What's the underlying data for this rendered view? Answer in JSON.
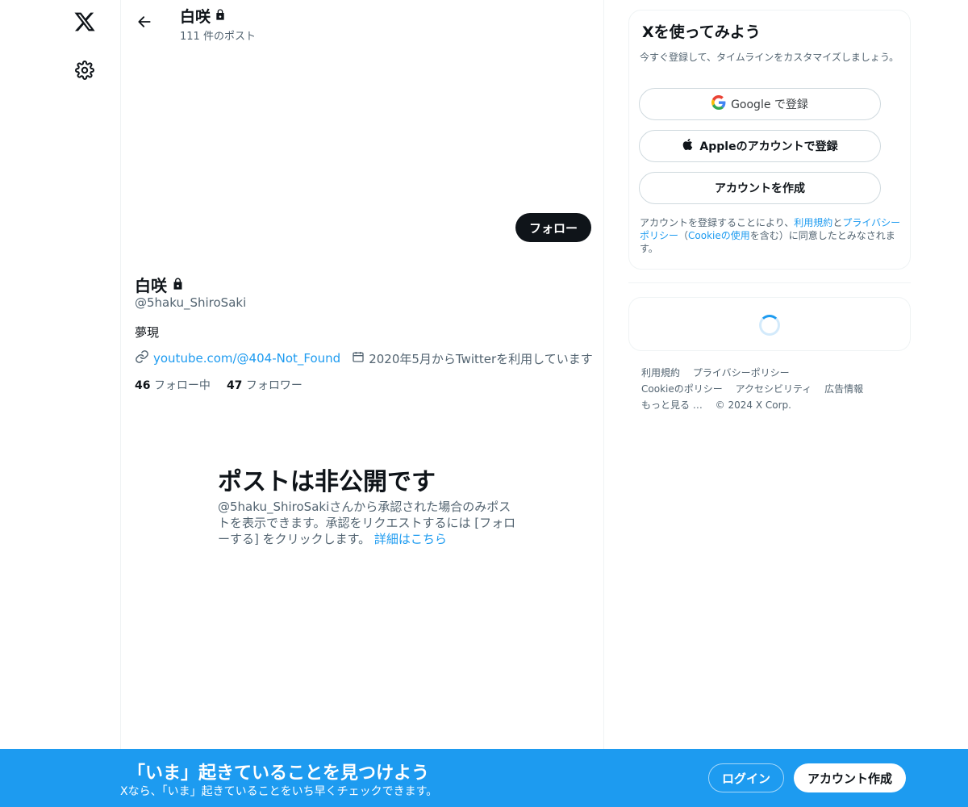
{
  "nav": {
    "logo_icon": "x-logo-icon",
    "settings_icon": "gear-icon"
  },
  "header": {
    "display_name": "白咲",
    "post_count": "111 件のポスト"
  },
  "profile": {
    "follow_label": "フォロー",
    "display_name": "白咲",
    "handle": "@5haku_ShiroSaki",
    "bio": "夢現",
    "website": "youtube.com/@404-Not_Found",
    "joined": "2020年5月からTwitterを利用しています",
    "following_count": "46",
    "following_label": "フォロー中",
    "followers_count": "47",
    "followers_label": "フォロワー"
  },
  "private_notice": {
    "title": "ポストは非公開です",
    "description": "@5haku_ShiroSakiさんから承認された場合のみポストを表示できます。承認をリクエストするには [フォローする] をクリックします。",
    "link": "詳細はこちら"
  },
  "signup": {
    "title": "Xを使ってみよう",
    "subtitle": "今すぐ登録して、タイムラインをカスタマイズしましょう。",
    "google_label": "Google で登録",
    "apple_label": "Appleのアカウントで登録",
    "create_label": "アカウントを作成",
    "terms_prefix": "アカウントを登録することにより、",
    "terms_link": "利用規約",
    "terms_and": "と",
    "privacy_link": "プライバシーポリシー",
    "terms_paren_open": "（",
    "cookie_link": "Cookieの使用",
    "terms_suffix": "を含む）に同意したとみなされます。"
  },
  "footer": {
    "terms": "利用規約",
    "privacy": "プライバシーポリシー",
    "cookie": "Cookieのポリシー",
    "accessibility": "アクセシビリティ",
    "ads": "広告情報",
    "more": "もっと見る …",
    "copyright": "© 2024 X Corp."
  },
  "bottom_bar": {
    "title": "「いま」起きていることを見つけよう",
    "subtitle": "Xなら、「いま」起きていることをいち早くチェックできます。",
    "login_label": "ログイン",
    "signup_label": "アカウント作成"
  },
  "colors": {
    "accent": "#1d9bf0",
    "text": "#0f1419",
    "secondary": "#536471"
  }
}
